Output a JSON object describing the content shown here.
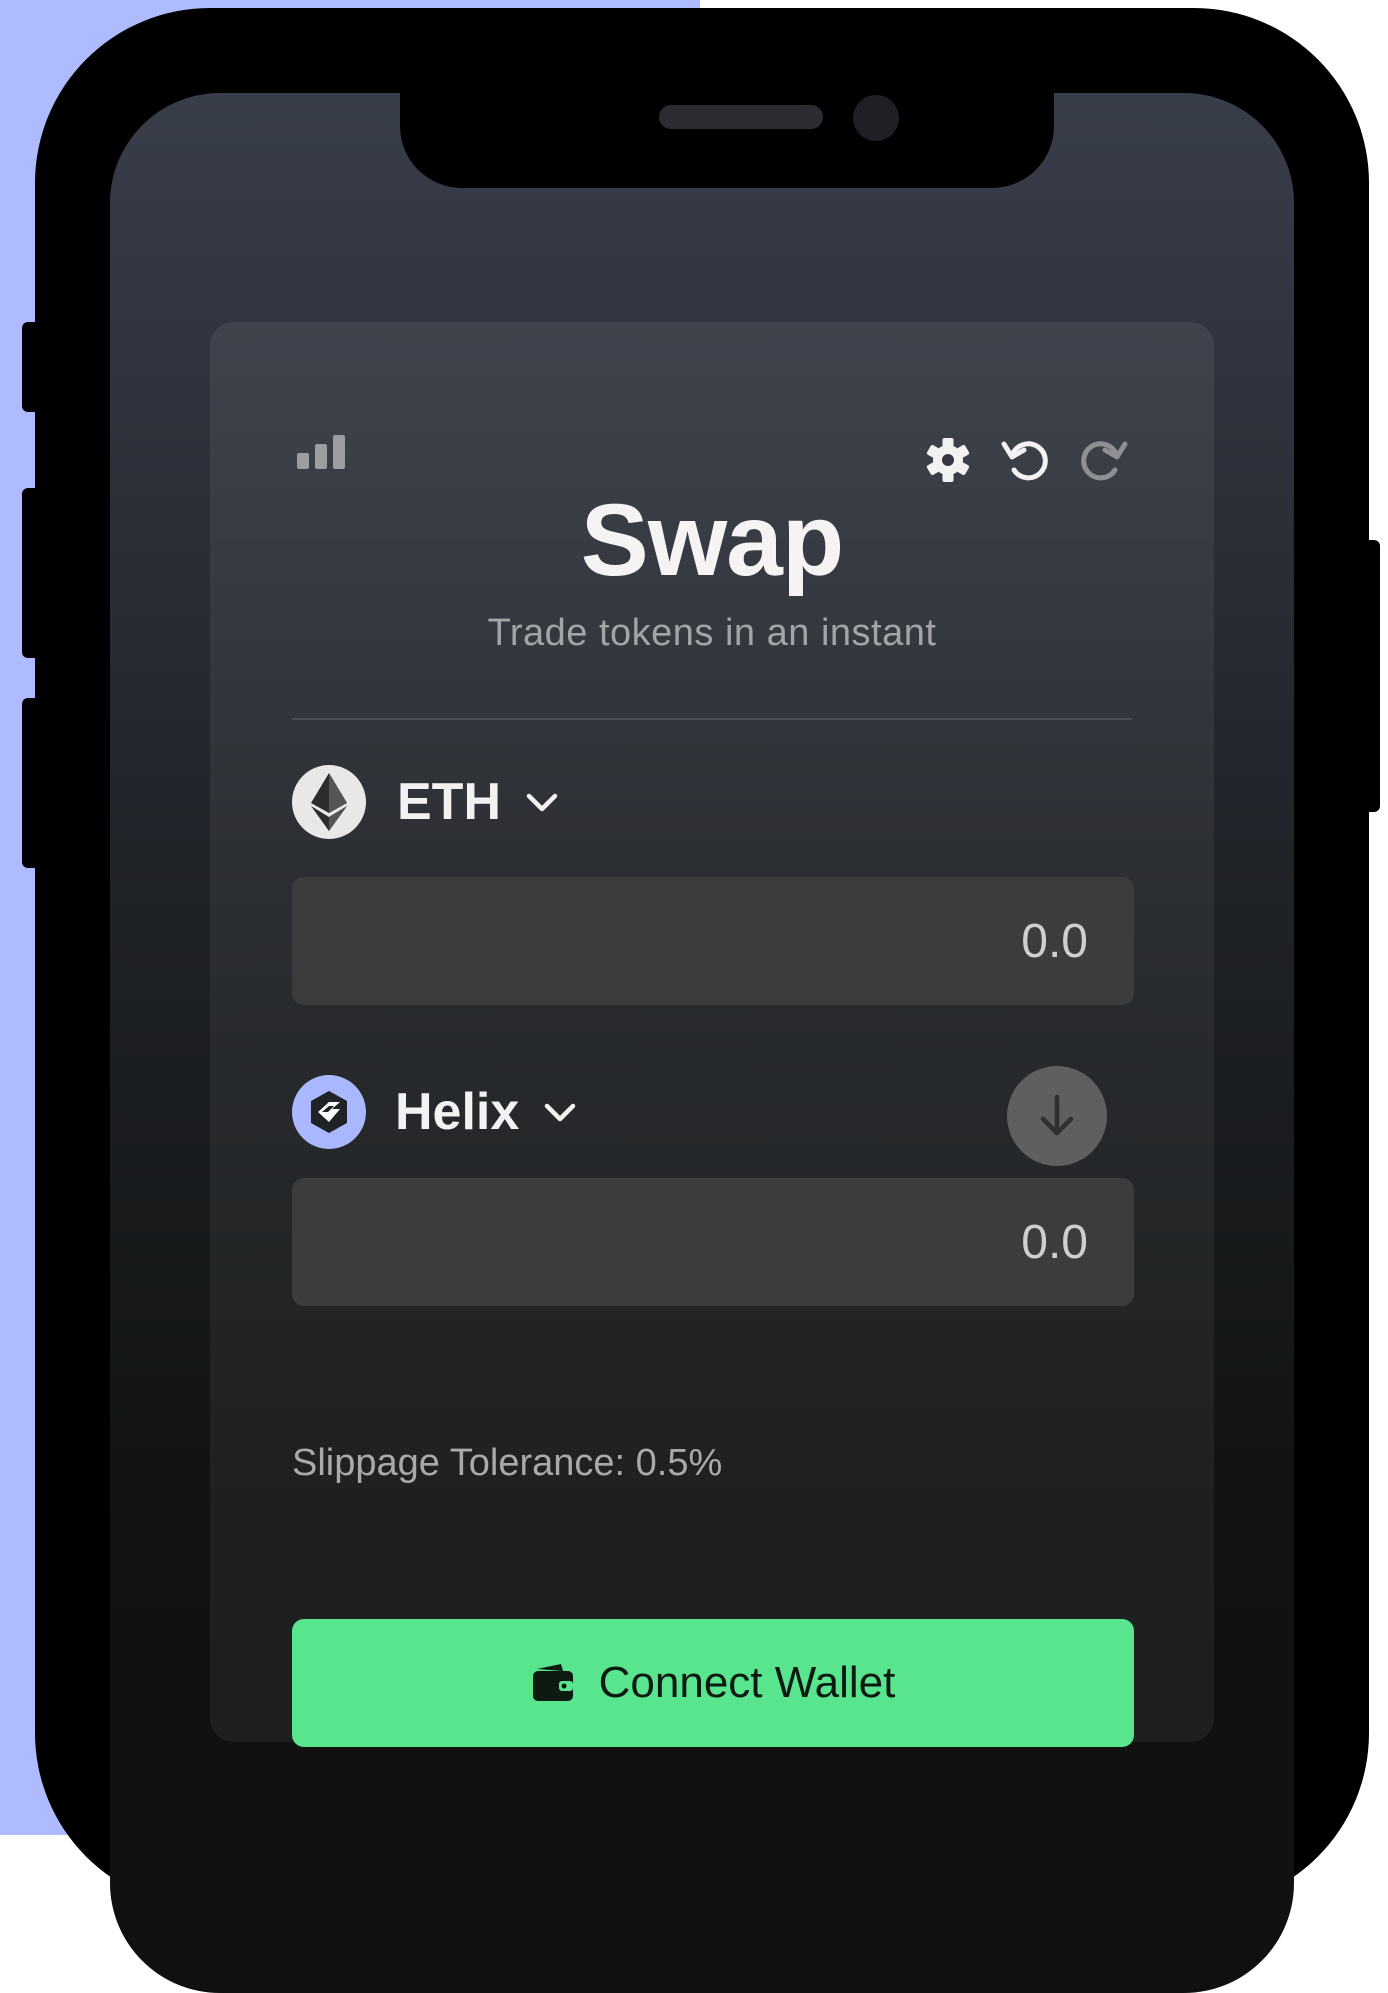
{
  "app": {
    "title": "Swap",
    "subtitle": "Trade tokens in an instant"
  },
  "from_token": {
    "symbol": "ETH",
    "amount_placeholder": "0.0",
    "logo_icon": "ethereum-icon"
  },
  "to_token": {
    "symbol": "Helix",
    "amount_placeholder": "0.0",
    "logo_icon": "helix-icon"
  },
  "slippage_text": "Slippage Tolerance: 0.5%",
  "connect_button": {
    "label": "Connect Wallet",
    "icon": "wallet-icon"
  },
  "toolbar": {
    "icons": [
      "signal-icon",
      "gear-icon",
      "undo-icon",
      "redo-icon"
    ]
  },
  "colors": {
    "accent_green": "#58e58e",
    "helix_blue": "#a9b8ff",
    "background_periwinkle": "#aebcff",
    "card_dark": "#2b2e33"
  }
}
